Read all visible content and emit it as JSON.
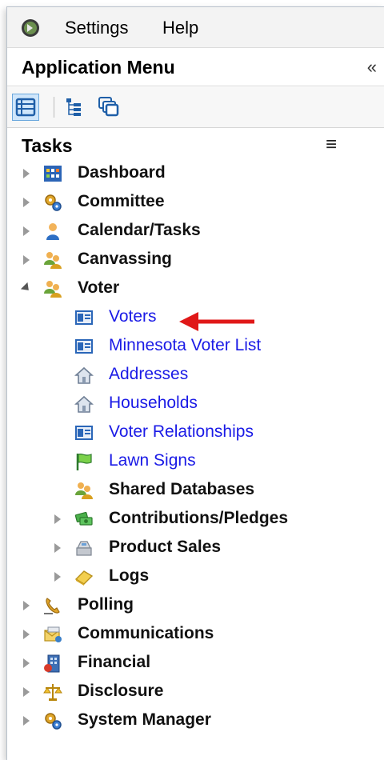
{
  "menubar": {
    "items": [
      "Settings",
      "Help"
    ]
  },
  "panel": {
    "title": "Application Menu",
    "collapse_glyph": "«"
  },
  "tasks": {
    "title": "Tasks",
    "menu_glyph": "≡"
  },
  "tree": [
    {
      "label": "Dashboard",
      "icon": "dashboard-icon",
      "expanded": false
    },
    {
      "label": "Committee",
      "icon": "gears-icon",
      "expanded": false
    },
    {
      "label": "Calendar/Tasks",
      "icon": "person-icon",
      "expanded": false
    },
    {
      "label": "Canvassing",
      "icon": "people-icon",
      "expanded": false
    },
    {
      "label": "Voter",
      "icon": "people-icon",
      "expanded": true,
      "children": [
        {
          "label": "Voters",
          "icon": "id-card-icon",
          "type": "link"
        },
        {
          "label": "Minnesota Voter List",
          "icon": "id-card-icon",
          "type": "link"
        },
        {
          "label": "Addresses",
          "icon": "house-icon",
          "type": "link"
        },
        {
          "label": "Households",
          "icon": "house-icon",
          "type": "link"
        },
        {
          "label": "Voter Relationships",
          "icon": "id-card-icon",
          "type": "link"
        },
        {
          "label": "Lawn Signs",
          "icon": "flag-icon",
          "type": "link"
        },
        {
          "label": "Shared Databases",
          "icon": "people-icon",
          "type": "bold"
        },
        {
          "label": "Contributions/Pledges",
          "icon": "money-icon",
          "type": "group"
        },
        {
          "label": "Product Sales",
          "icon": "register-icon",
          "type": "group"
        },
        {
          "label": "Logs",
          "icon": "eraser-icon",
          "type": "group"
        }
      ]
    },
    {
      "label": "Polling",
      "icon": "phone-icon",
      "expanded": false
    },
    {
      "label": "Communications",
      "icon": "mail-icon",
      "expanded": false
    },
    {
      "label": "Financial",
      "icon": "building-icon",
      "expanded": false
    },
    {
      "label": "Disclosure",
      "icon": "scales-icon",
      "expanded": false
    },
    {
      "label": "System Manager",
      "icon": "gears-icon",
      "expanded": false
    }
  ],
  "colors": {
    "link": "#1a1ae6",
    "arrow": "#e01818",
    "accent": "#3a7fc8"
  }
}
